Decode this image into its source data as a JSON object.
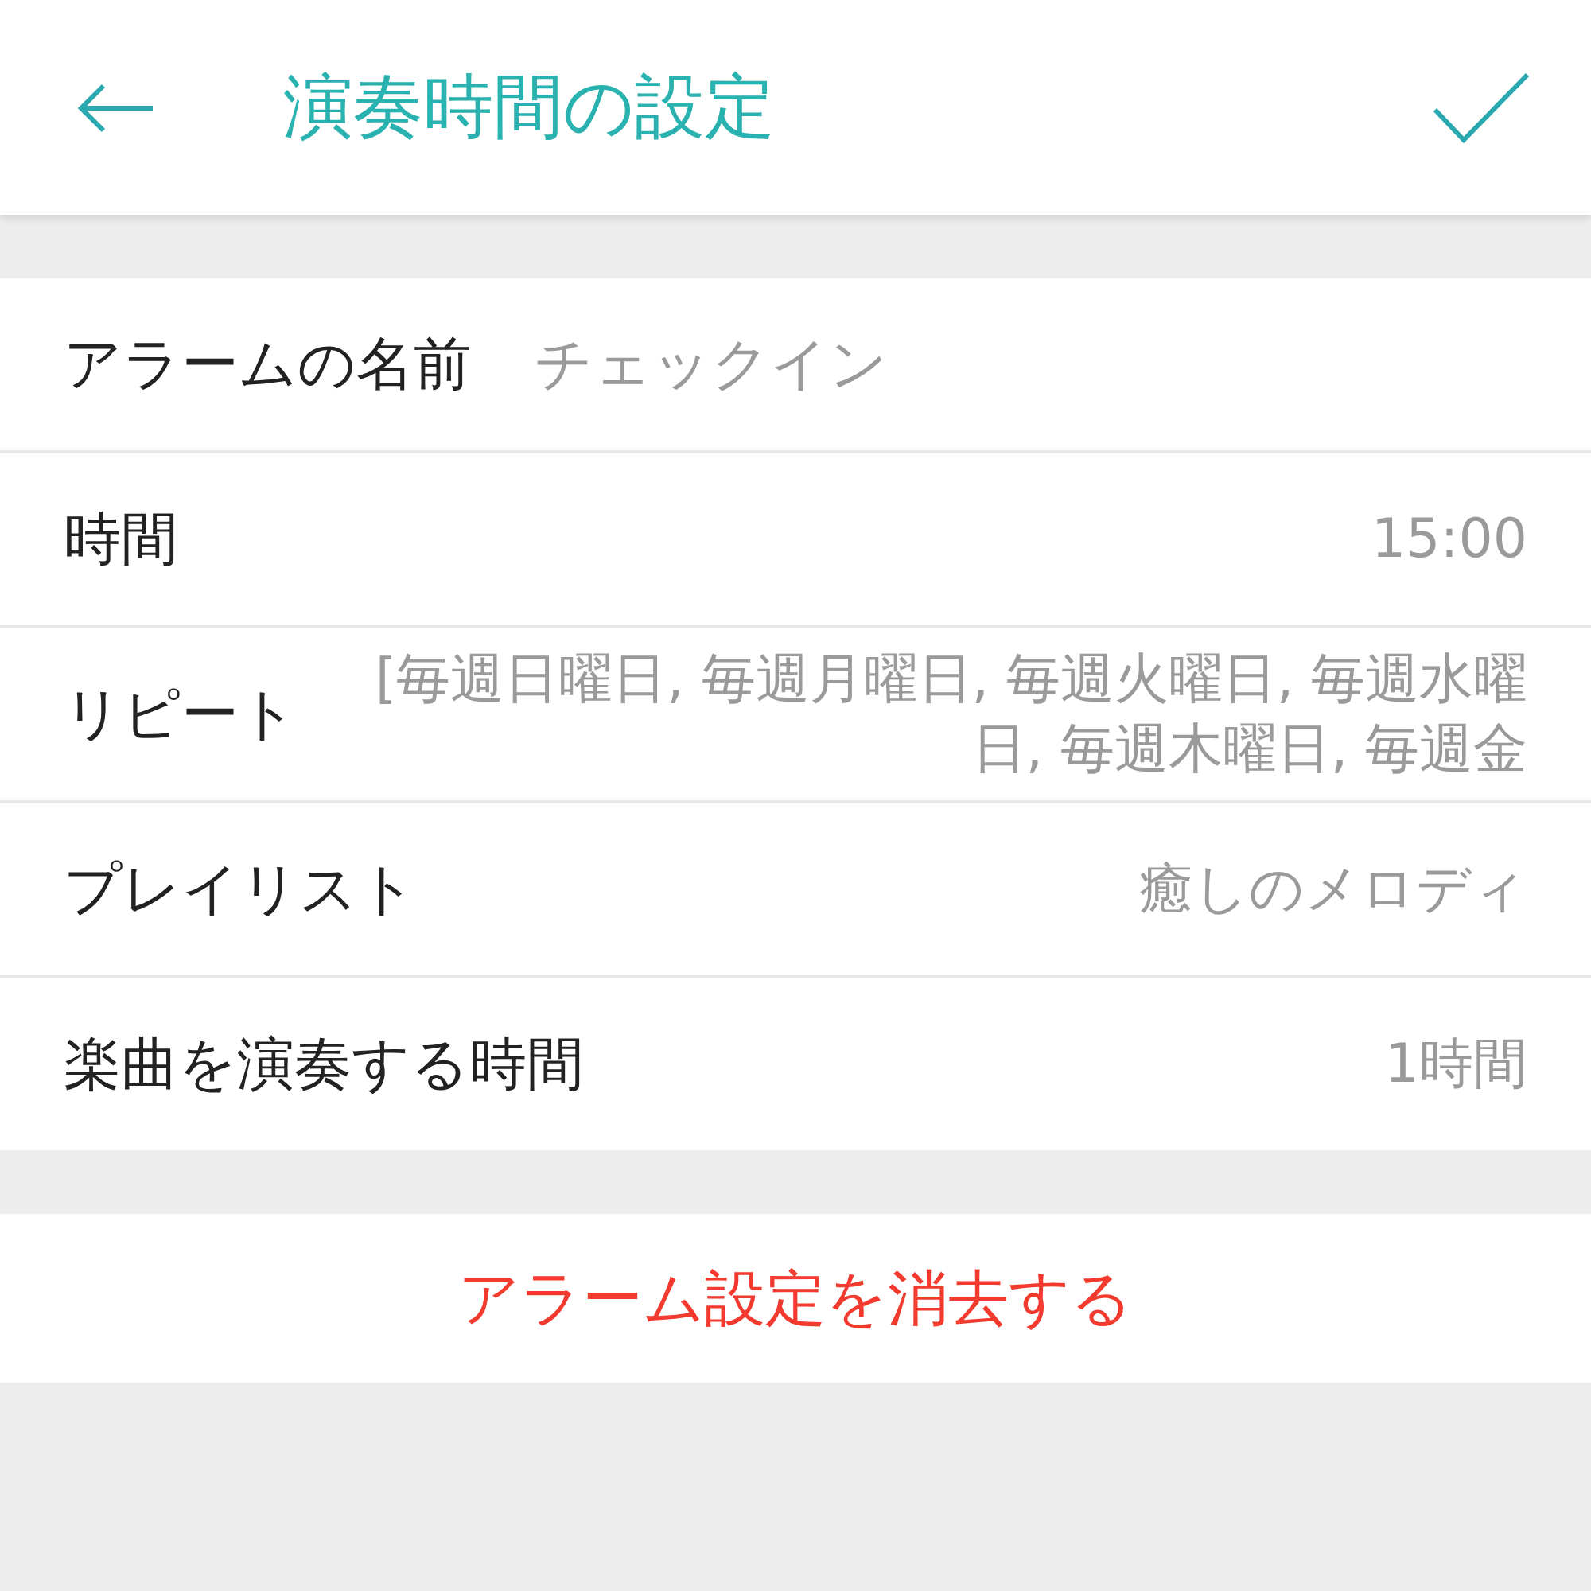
{
  "header": {
    "title": "演奏時間の設定"
  },
  "settings": [
    {
      "kind": "field",
      "label": "アラームの名前",
      "placeholder": "チェックイン"
    },
    {
      "kind": "value",
      "label": "時間",
      "value": "15:00"
    },
    {
      "kind": "value",
      "label": "リピート",
      "value": "[毎週日曜日, 毎週月曜日, 毎週火曜日, 毎週水曜日, 毎週木曜日, 毎週金"
    },
    {
      "kind": "value",
      "label": "プレイリスト",
      "value": "癒しのメロディ"
    },
    {
      "kind": "value",
      "label": "楽曲を演奏する時間",
      "value": "1時間"
    }
  ],
  "delete_button": "アラーム設定を消去する"
}
